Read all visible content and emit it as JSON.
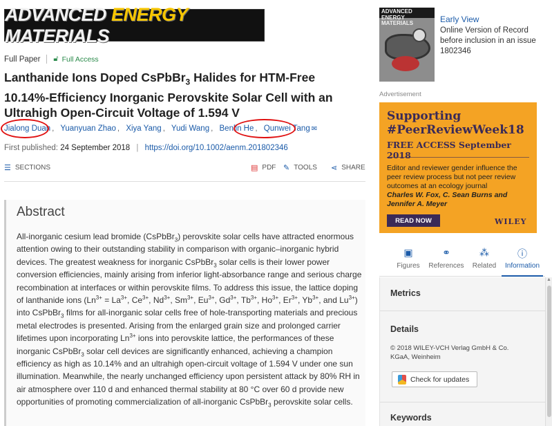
{
  "journal": {
    "name_part1": "ADVANCED ",
    "name_part2": "ENERGY",
    "name_part3": " MATERIALS"
  },
  "article": {
    "type": "Full Paper",
    "access": "Full Access",
    "title_part1": "Lanthanide Ions Doped CsPbBr",
    "title_sub": "3",
    "title_part2": " Halides for HTM-Free 10.14%-Efficiency Inorganic Perovskite Solar Cell with an Ultrahigh Open-Circuit Voltage of 1.594 V",
    "authors": [
      "Jialong Duan",
      "Yuanyuan Zhao",
      "Xiya Yang",
      "Yudi Wang",
      "Benlin He",
      "Qunwei Tang"
    ],
    "first_published_label": "First published:",
    "first_published_date": "24 September 2018",
    "doi": "https://doi.org/10.1002/aenm.201802346"
  },
  "toolbar": {
    "sections": "SECTIONS",
    "pdf": "PDF",
    "tools": "TOOLS",
    "share": "SHARE"
  },
  "abstract": {
    "heading": "Abstract",
    "t1": "All-inorganic cesium lead bromide (CsPbBr",
    "t2": ") perovskite solar cells have attracted enormous attention owing to their outstanding stability in comparison with organic–inorganic hybrid devices. The greatest weakness for inorganic CsPbBr",
    "t3": " solar cells is their lower power conversion efficiencies, mainly arising from inferior light-absorbance range and serious charge recombination at interfaces or within perovskite films. To address this issue, the lattice doping of lanthanide ions (Ln",
    "t4": " = La",
    "t5": ", Ce",
    "t6": ", Nd",
    "t7": ", Sm",
    "t8": ", Eu",
    "t9": ", Gd",
    "t10": ", Tb",
    "t11": ", Ho",
    "t12": ", Er",
    "t13": ", Yb",
    "t14": ", and Lu",
    "t15": ") into CsPbBr",
    "t16": " films for all-inorganic solar cells free of hole-transporting materials and precious metal electrodes is presented. Arising from the enlarged grain size and prolonged carrier lifetimes upon incorporating Ln",
    "t17": " ions into perovskite lattice, the performances of these inorganic CsPbBr",
    "t18": " solar cell devices are significantly enhanced, achieving a champion efficiency as high as 10.14% and an ultrahigh open-circuit voltage of 1.594 V under one sun illumination. Meanwhile, the nearly unchanged efficiency upon persistent attack by 80% RH in air atmosphere over 110 d and enhanced thermal stability at 80 °C over 60 d provide new opportunities of promoting commercialization of all-inorganic CsPbBr",
    "t19": " perovskite solar cells.",
    "sub3": "3",
    "sup3plus": "3+"
  },
  "issue": {
    "cover_title": "ADVANCED ENERGY MATERIALS",
    "early_view": "Early View",
    "online_version": "Online Version of Record before inclusion in an issue",
    "article_number": "1802346"
  },
  "ad": {
    "label": "Advertisement",
    "headline": "Supporting #PeerReviewWeek18",
    "subline": "FREE ACCESS September 2018",
    "body": "Editor and reviewer gender influence the peer review process but not peer review outcomes at an ecology journal",
    "authors": "Charles W. Fox, C. Sean Burns and Jennifer A. Meyer",
    "button": "READ NOW",
    "logo": "WILEY"
  },
  "side_tabs": [
    {
      "label": "Figures"
    },
    {
      "label": "References"
    },
    {
      "label": "Related"
    },
    {
      "label": "Information"
    }
  ],
  "side_panel": {
    "metrics": "Metrics",
    "details": "Details",
    "copyright": "© 2018 WILEY-VCH Verlag GmbH & Co. KGaA, Weinheim",
    "check_updates": "Check for updates",
    "keywords": "Keywords"
  },
  "colors": {
    "link": "#1a5aa8",
    "annotation_circle": "#e01010",
    "ad_background": "#f4a324",
    "ad_ink": "#3a2a57",
    "access_green": "#2a8a4a"
  }
}
